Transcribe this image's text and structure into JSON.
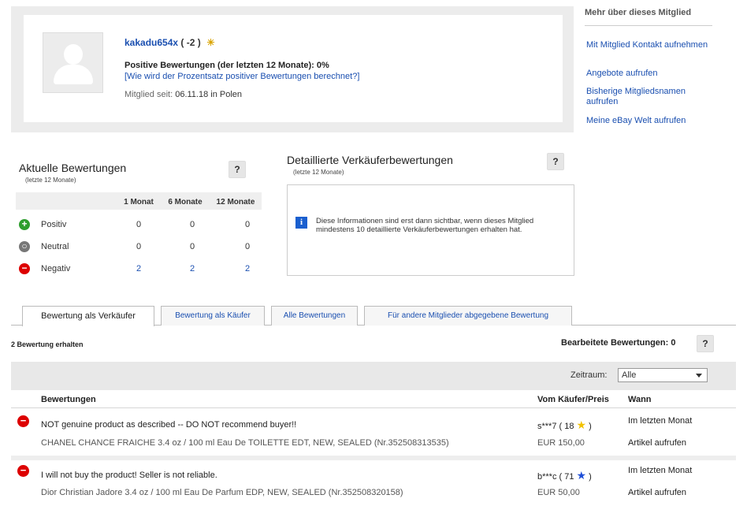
{
  "profile": {
    "username": "kakadu654x",
    "score": "( -2 )",
    "badge_icon": "bulb-icon",
    "positive_line": "Positive Bewertungen (der letzten 12 Monate): 0%",
    "calc_link": "[Wie wird der Prozentsatz positiver Bewertungen berechnet?]",
    "member_label": "Mitglied seit:",
    "member_value": "06.11.18 in Polen"
  },
  "sidebar": {
    "title": "Mehr über dieses Mitglied",
    "links": [
      "Mit Mitglied Kontakt aufnehmen",
      "Angebote aufrufen",
      "Bisherige Mitgliedsnamen aufrufen",
      "Meine eBay Welt aufrufen"
    ]
  },
  "current": {
    "title": "Aktuelle Bewertungen",
    "subtitle": "(letzte 12 Monate)",
    "help": "?",
    "columns": [
      "1 Monat",
      "6 Monate",
      "12 Monate"
    ],
    "rows": [
      {
        "label": "Positiv",
        "values": [
          "0",
          "0",
          "0"
        ],
        "color": "#2e9e2e"
      },
      {
        "label": "Neutral",
        "values": [
          "0",
          "0",
          "0"
        ],
        "color": "#777777"
      },
      {
        "label": "Negativ",
        "values": [
          "2",
          "2",
          "2"
        ],
        "color": "#dd0000"
      }
    ]
  },
  "detail": {
    "title": "Detaillierte Verkäuferbewertungen",
    "subtitle": "(letzte 12 Monate)",
    "help": "?",
    "info": "Diese Informationen sind erst dann sichtbar, wenn dieses Mitglied mindestens 10 detaillierte Verkäuferbewertungen erhalten hat."
  },
  "tabs": [
    "Bewertung als Verkäufer",
    "Bewertung als Käufer",
    "Alle Bewertungen",
    "Für andere Mitglieder abgegebene Bewertung"
  ],
  "received": "2 Bewertung erhalten",
  "edited": "Bearbeitete Bewertungen: 0",
  "edited_help": "?",
  "filter": {
    "label": "Zeitraum:",
    "selected": "Alle"
  },
  "table": {
    "headers": [
      "Bewertungen",
      "Vom Käufer/Preis",
      "Wann"
    ],
    "rows": [
      {
        "comment": "NOT genuine product as described -- DO NOT recommend buyer!!",
        "item": "CHANEL CHANCE FRAICHE 3.4 oz / 100 ml Eau De TOILETTE EDT, NEW, SEALED (Nr.352508313535)",
        "buyer": "s***7 ( 18",
        "buyer_close": " )",
        "star_color": "#f2c200",
        "price": "EUR 150,00",
        "when": "Im letzten Monat",
        "link": "Artikel aufrufen"
      },
      {
        "comment": "I will not buy the product! Seller is not reliable.",
        "item": "Dior Christian Jadore 3.4 oz / 100 ml Eau De Parfum EDP, NEW, SEALED (Nr.352508320158)",
        "buyer": "b***c ( 71",
        "buyer_close": " )",
        "star_color": "#1f4fd8",
        "price": "EUR 50,00",
        "when": "Im letzten Monat",
        "link": "Artikel aufrufen"
      }
    ]
  }
}
